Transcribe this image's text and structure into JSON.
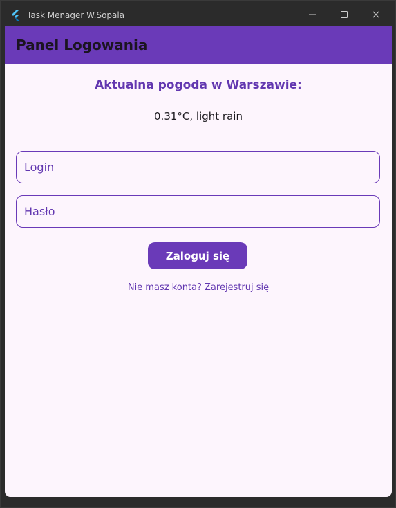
{
  "window": {
    "title": "Task Menager W.Sopala",
    "app_icon": "flutter-icon"
  },
  "window_controls": {
    "minimize_icon": "minimize-icon",
    "maximize_icon": "maximize-icon",
    "close_icon": "close-icon"
  },
  "appbar": {
    "title": "Panel Logowania"
  },
  "weather": {
    "heading": "Aktualna pogoda w Warszawie:",
    "value": "0.31°C, light rain"
  },
  "form": {
    "login_placeholder": "Login",
    "password_placeholder": "Hasło",
    "login_button": "Zaloguj się",
    "register_link": "Nie masz konta? Zarejestruj się"
  },
  "colors": {
    "primary": "#6a3ab8",
    "background": "#fdf5fd",
    "titlebar": "#2b2b2b"
  }
}
